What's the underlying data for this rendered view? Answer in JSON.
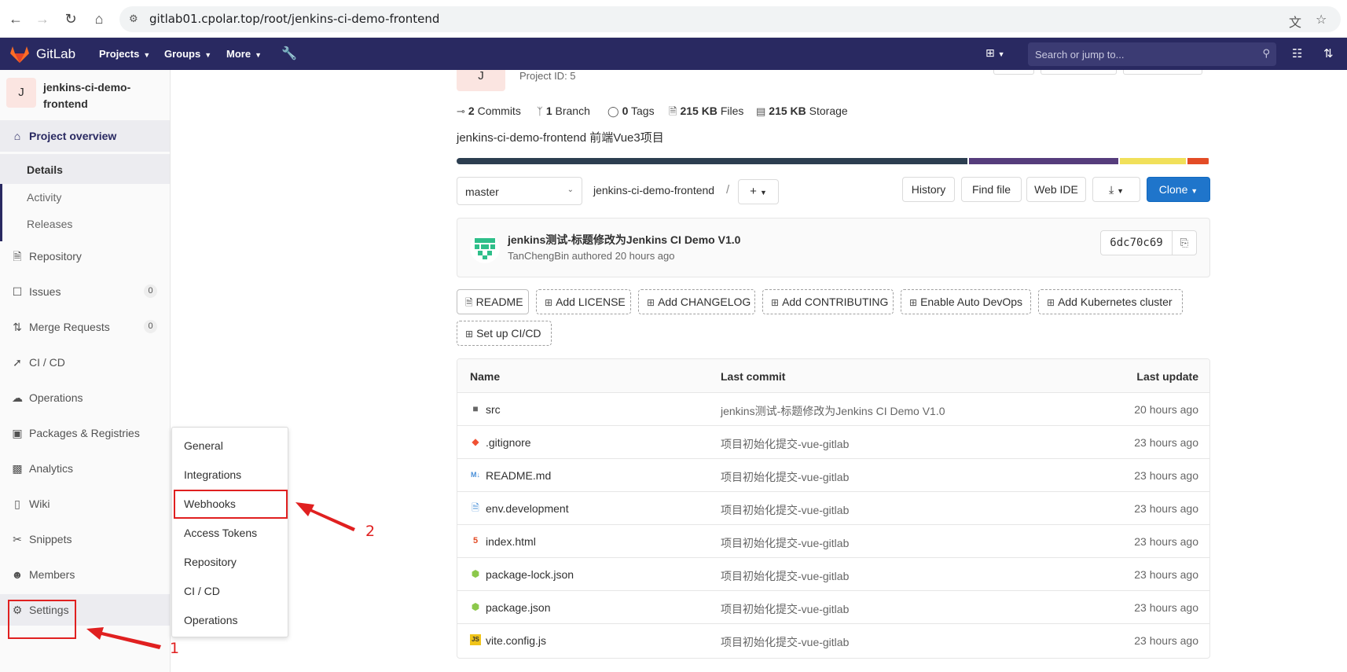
{
  "browser": {
    "url": "gitlab01.cpolar.top/root/jenkins-ci-demo-frontend"
  },
  "header": {
    "brand": "GitLab",
    "menus": [
      "Projects",
      "Groups",
      "More"
    ],
    "search_placeholder": "Search or jump to..."
  },
  "sidebar": {
    "avatar_letter": "J",
    "project_name": "jenkins-ci-demo-frontend",
    "overview": "Project overview",
    "sub_items": [
      "Details",
      "Activity",
      "Releases"
    ],
    "items": [
      {
        "label": "Repository",
        "icon": "book-icon"
      },
      {
        "label": "Issues",
        "icon": "issues-icon",
        "count": "0"
      },
      {
        "label": "Merge Requests",
        "icon": "merge-request-icon",
        "count": "0"
      },
      {
        "label": "CI / CD",
        "icon": "rocket-icon"
      },
      {
        "label": "Operations",
        "icon": "cloud-gear-icon"
      },
      {
        "label": "Packages & Registries",
        "icon": "package-icon"
      },
      {
        "label": "Analytics",
        "icon": "chart-icon"
      },
      {
        "label": "Wiki",
        "icon": "book-icon"
      },
      {
        "label": "Snippets",
        "icon": "scissors-icon"
      },
      {
        "label": "Members",
        "icon": "users-icon"
      },
      {
        "label": "Settings",
        "icon": "gear-icon"
      }
    ]
  },
  "flyout": {
    "items": [
      "General",
      "Integrations",
      "Webhooks",
      "Access Tokens",
      "Repository",
      "CI / CD",
      "Operations"
    ]
  },
  "annotations": {
    "step1": "1",
    "step2": "2",
    "color": "#e02020"
  },
  "project": {
    "avatar_letter": "J",
    "id_text": "Project ID: 5",
    "stats": {
      "commits_num": "2",
      "commits_label": "Commits",
      "branch_num": "1",
      "branch_label": "Branch",
      "tags_num": "0",
      "tags_label": "Tags",
      "files_num": "215 KB",
      "files_label": "Files",
      "storage_num": "215 KB",
      "storage_label": "Storage"
    },
    "description": "jenkins-ci-demo-frontend 前端Vue3项目",
    "languages": [
      {
        "share": 0.68,
        "color": "#2c3e50"
      },
      {
        "share": 0.2,
        "color": "#563d7c"
      },
      {
        "share": 0.09,
        "color": "#f1e05a"
      },
      {
        "share": 0.03,
        "color": "#e34c26"
      }
    ]
  },
  "toolbar": {
    "branch": "master",
    "path": "jenkins-ci-demo-frontend",
    "separator": "/",
    "buttons": [
      "History",
      "Find file",
      "Web IDE"
    ],
    "clone": "Clone"
  },
  "commit": {
    "title": "jenkins测试-标题修改为Jenkins CI Demo V1.0",
    "author": "TanChengBin",
    "meta_rest": " authored 20 hours ago",
    "sha": "6dc70c69"
  },
  "pills": {
    "readme": "README",
    "license": "Add LICENSE",
    "changelog": "Add CHANGELOG",
    "contributing": "Add CONTRIBUTING",
    "devops": "Enable Auto DevOps",
    "k8s": "Add Kubernetes cluster",
    "cicd": "Set up CI/CD"
  },
  "files": {
    "headers": {
      "name": "Name",
      "commit": "Last commit",
      "update": "Last update"
    },
    "rows": [
      {
        "name": "src",
        "commit": "jenkins测试-标题修改为Jenkins CI Demo V1.0",
        "update": "20 hours ago",
        "icon": "folder-icon"
      },
      {
        "name": ".gitignore",
        "commit": "项目初始化提交-vue-gitlab",
        "update": "23 hours ago",
        "icon": "git-icon"
      },
      {
        "name": "README.md",
        "commit": "项目初始化提交-vue-gitlab",
        "update": "23 hours ago",
        "icon": "markdown-icon"
      },
      {
        "name": "env.development",
        "commit": "项目初始化提交-vue-gitlab",
        "update": "23 hours ago",
        "icon": "file-icon"
      },
      {
        "name": "index.html",
        "commit": "项目初始化提交-vue-gitlab",
        "update": "23 hours ago",
        "icon": "html-icon"
      },
      {
        "name": "package-lock.json",
        "commit": "项目初始化提交-vue-gitlab",
        "update": "23 hours ago",
        "icon": "node-icon"
      },
      {
        "name": "package.json",
        "commit": "项目初始化提交-vue-gitlab",
        "update": "23 hours ago",
        "icon": "node-icon"
      },
      {
        "name": "vite.config.js",
        "commit": "项目初始化提交-vue-gitlab",
        "update": "23 hours ago",
        "icon": "js-icon"
      }
    ]
  }
}
